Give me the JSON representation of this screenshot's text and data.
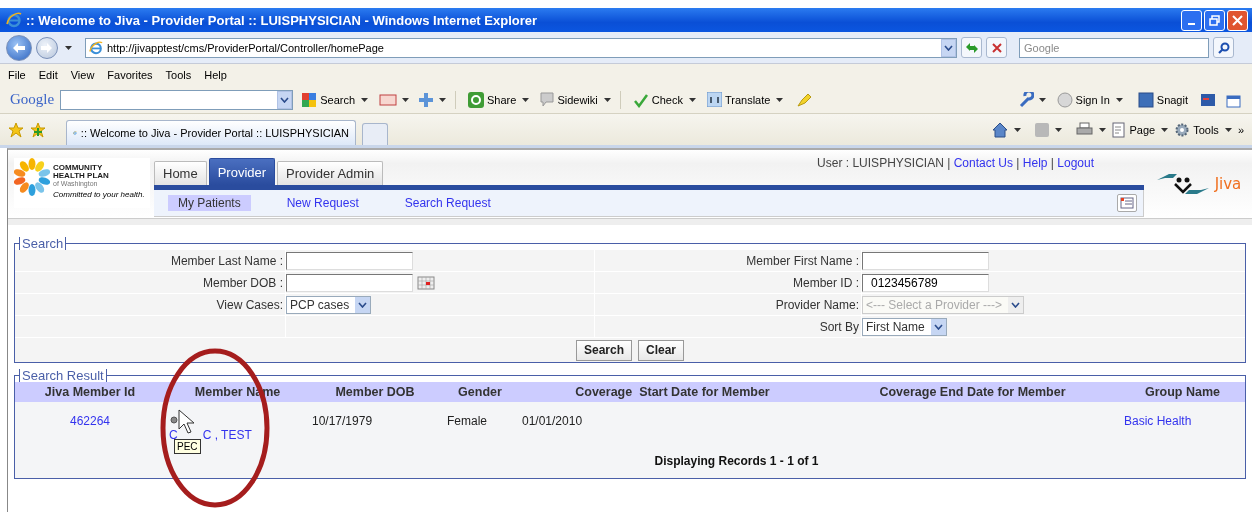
{
  "window": {
    "title": ":: Welcome to Jiva - Provider Portal :: LUISPHYSICIAN - Windows Internet Explorer"
  },
  "address_bar": {
    "url": "http://jivapptest/cms/ProviderPortal/Controller/homePage"
  },
  "web_search": {
    "placeholder": "Google"
  },
  "menu": [
    "File",
    "Edit",
    "View",
    "Favorites",
    "Tools",
    "Help"
  ],
  "google_toolbar": {
    "logo": "Google",
    "items": [
      "Search",
      "Share",
      "Sidewiki",
      "Check",
      "Translate"
    ],
    "sign_in": "Sign In",
    "snagit": "Snagit"
  },
  "browser_tab": {
    "title": ":: Welcome to Jiva - Provider Portal :: LUISPHYSICIAN"
  },
  "command_bar": {
    "items": [
      "Page",
      "Tools"
    ],
    "more": "»"
  },
  "portal": {
    "logo": {
      "name_lines": [
        "COMMUNITY",
        "HEALTH PLAN"
      ],
      "region": "of Washington",
      "tagline": "Committed to your health."
    },
    "tabs": [
      {
        "label": "Home",
        "selected": false
      },
      {
        "label": "Provider",
        "selected": true
      },
      {
        "label": "Provider Admin",
        "selected": false
      }
    ],
    "subnav": [
      {
        "label": "My Patients",
        "selected": true
      },
      {
        "label": "New Request",
        "selected": false
      },
      {
        "label": "Search Request",
        "selected": false
      }
    ],
    "header_items": [
      {
        "kind": "text",
        "label": "User : LUISPHYSICIAN"
      },
      {
        "kind": "separator",
        "label": "|"
      },
      {
        "kind": "link",
        "label": "Contact Us"
      },
      {
        "kind": "separator",
        "label": "|"
      },
      {
        "kind": "link",
        "label": "Help"
      },
      {
        "kind": "separator",
        "label": "|"
      },
      {
        "kind": "link",
        "label": "Logout"
      }
    ],
    "brand": "Jiva"
  },
  "search": {
    "legend": "Search",
    "rows": [
      {
        "left": {
          "kind": "text",
          "label": "Member Last Name :"
        },
        "right": {
          "kind": "text",
          "label": "Member First Name :"
        }
      },
      {
        "left": {
          "kind": "date",
          "label": "Member DOB :"
        },
        "right": {
          "kind": "text",
          "label": "Member ID :",
          "value": "0123456789"
        }
      },
      {
        "left": {
          "kind": "select",
          "label": "View Cases:",
          "value": "PCP cases",
          "disabled": false
        },
        "right": {
          "kind": "select",
          "label": "Provider Name:",
          "value": "<--- Select a Provider --->",
          "disabled": true
        }
      },
      {
        "right": {
          "kind": "select",
          "label": "Sort By",
          "value": "First Name",
          "disabled": false
        }
      }
    ],
    "buttons": [
      "Search",
      "Clear"
    ]
  },
  "results": {
    "legend": "Search Result",
    "columns": [
      "Jiva Member Id",
      "Member Name",
      "Member DOB",
      "Gender",
      "Coverage  Start Date for Member",
      "Coverage End Date for Member",
      "Group Name"
    ],
    "rows": [
      {
        "member_id": "462264",
        "name_parts": [
          "C",
          "C , TEST"
        ],
        "dob": "10/17/1979",
        "gender": "Female",
        "coverage_start": "01/01/2010",
        "group": "Basic Health"
      }
    ],
    "footer": "Displaying Records 1 - 1 of 1"
  },
  "tooltip": {
    "text": "PEC"
  }
}
